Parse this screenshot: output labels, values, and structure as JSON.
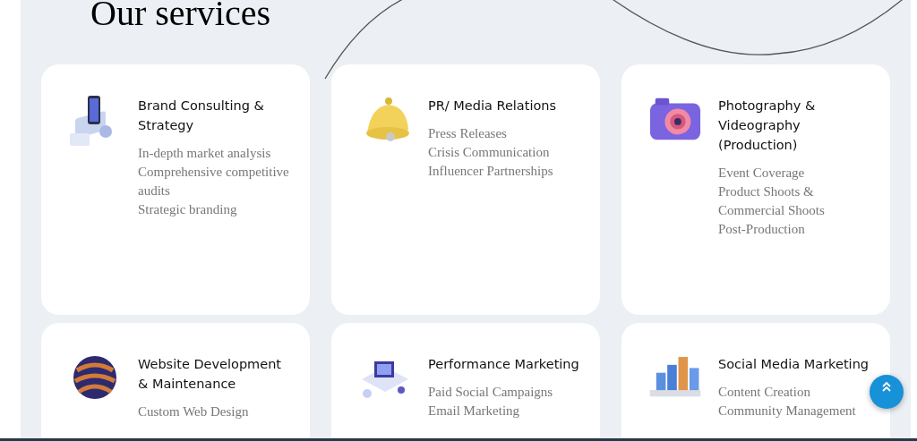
{
  "heading": "Our services",
  "services": [
    {
      "kind": "phone",
      "title": "Brand Consulting & Strategy",
      "items": [
        "In-depth market analysis",
        "Comprehensive competitive audits",
        "Strategic branding"
      ]
    },
    {
      "kind": "bell",
      "title": "PR/ Media Relations",
      "items": [
        "Press Releases",
        "Crisis Communication",
        "Influencer Partnerships"
      ]
    },
    {
      "kind": "camera",
      "title": "Photography & Videography (Production)",
      "items": [
        "Event Coverage",
        "Product Shoots & Commercial Shoots",
        "Post-Production"
      ]
    },
    {
      "kind": "sphere",
      "title": "Website Development & Maintenance",
      "items": [
        "Custom Web Design"
      ]
    },
    {
      "kind": "isometric",
      "title": "Performance Marketing",
      "items": [
        "Paid Social Campaigns",
        "Email Marketing"
      ]
    },
    {
      "kind": "bars",
      "title": "Social Media Marketing",
      "items": [
        "Content Creation",
        "Community Management"
      ]
    }
  ]
}
